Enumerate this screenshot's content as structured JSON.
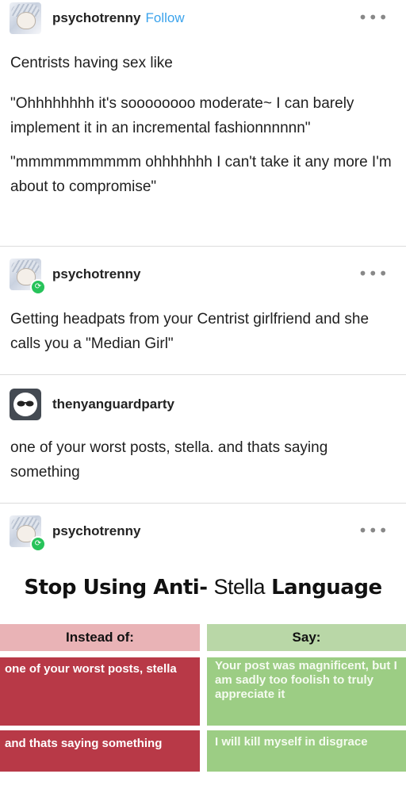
{
  "posts": [
    {
      "username": "psychotrenny",
      "follow_label": "Follow",
      "more_label": "•••",
      "paragraphs": [
        "Centrists having sex like",
        "\"Ohhhhhhhh it's soooooooo moderate~ I can barely implement it in an incremental fashionnnnnn\"",
        "\"mmmmmmmmmm ohhhhhhh I can't take it any more I'm about to compromise\""
      ]
    },
    {
      "username": "psychotrenny",
      "more_label": "•••",
      "paragraphs": [
        "Getting headpats from your Centrist girlfriend and she calls you a \"Median Girl\""
      ]
    },
    {
      "username": "thenyanguardparty",
      "paragraphs": [
        "one of your worst posts, stella. and thats saying something"
      ]
    },
    {
      "username": "psychotrenny",
      "more_label": "•••"
    }
  ],
  "graphic": {
    "title_left": "Stop Using Anti-",
    "title_mid": "Stella",
    "title_right": "Language",
    "header_left": "Instead of:",
    "header_right": "Say:",
    "rows": [
      {
        "instead": "one of your worst posts, stella",
        "say": "Your post was magnificent, but I am sadly too foolish to truly appreciate it"
      },
      {
        "instead": "and thats saying something",
        "say": "I will kill myself in disgrace"
      }
    ],
    "colors": {
      "header_left": "#e9b3b6",
      "header_right": "#b9d7a7",
      "red": "#b83947",
      "green": "#9ccd84"
    }
  },
  "icons": {
    "reblog": "reblog-icon",
    "more": "more-options-icon",
    "avatar_sunglasses": "sunglasses-icon"
  },
  "colors": {
    "follow": "#3ba3ec",
    "reblog_badge": "#27c35a",
    "divider": "#dcdcdc"
  }
}
